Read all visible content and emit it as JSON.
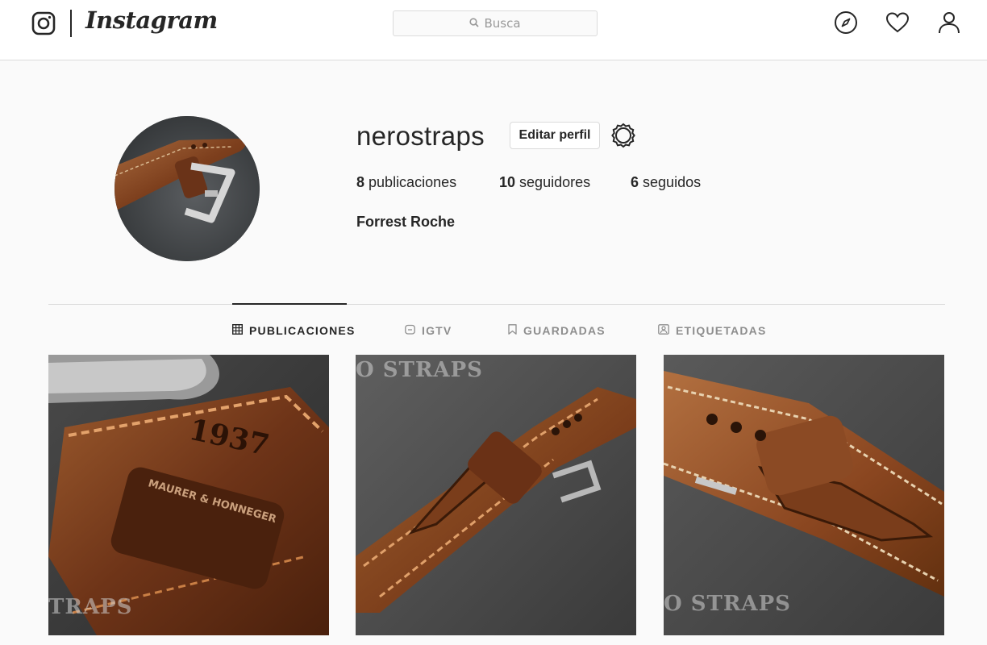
{
  "header": {
    "brand": "Instagram",
    "search_placeholder": "Busca"
  },
  "icons": {
    "logo": "instagram-glyph-icon",
    "search": "search-icon",
    "explore": "compass-icon",
    "activity": "heart-icon",
    "profile": "user-icon",
    "settings": "gear-icon",
    "posts_tab": "grid-icon",
    "igtv_tab": "tv-icon",
    "saved_tab": "bookmark-icon",
    "tagged_tab": "tag-icon"
  },
  "profile": {
    "username": "nerostraps",
    "edit_label": "Editar perfil",
    "full_name": "Forrest Roche",
    "stats": [
      {
        "count": "8",
        "label": "publicaciones"
      },
      {
        "count": "10",
        "label": "seguidores"
      },
      {
        "count": "6",
        "label": "seguidos"
      }
    ]
  },
  "tabs": [
    {
      "label": "PUBLICACIONES",
      "active": true
    },
    {
      "label": "IGTV",
      "active": false
    },
    {
      "label": "GUARDADAS",
      "active": false
    },
    {
      "label": "ETIQUETADAS",
      "active": false
    }
  ],
  "posts": [
    {
      "watermark": "TRAPS",
      "embossed_text": "1937",
      "plate_text": "MAURER & HONNEGER"
    },
    {
      "watermark": "O STRAPS"
    },
    {
      "watermark": "O STRAPS"
    }
  ],
  "colors": {
    "nav_bg": "#ffffff",
    "page_bg": "#fafafa",
    "border": "#dbdbdb",
    "text": "#262626",
    "muted": "#8e8e8e",
    "leather": "#8a4a22"
  }
}
